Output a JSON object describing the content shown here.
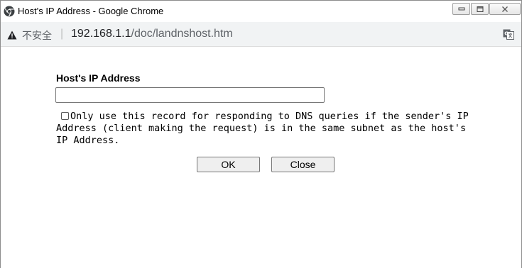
{
  "window": {
    "title": "Host's IP Address - Google Chrome"
  },
  "address_bar": {
    "security_label": "不安全",
    "separator": "|",
    "url_host": "192.168.1.1",
    "url_path": "/doc/landnshost.htm"
  },
  "form": {
    "field_label": "Host's IP Address",
    "ip_value": "",
    "ip_placeholder": "",
    "checkbox_checked": false,
    "checkbox_label": "Only use this record for responding to DNS queries if the sender's IP Address (client making the request) is in the same subnet as the host's IP Address.",
    "ok_label": "OK",
    "close_label": "Close"
  },
  "colors": {
    "address_bar_bg": "#f1f3f4",
    "button_bg": "#efefef",
    "border": "#767676"
  },
  "icons": {
    "title": "chrome-icon",
    "security": "warning-icon",
    "translate": "translate-icon",
    "minimize": "minimize-icon",
    "maximize": "maximize-icon",
    "close": "close-icon"
  }
}
